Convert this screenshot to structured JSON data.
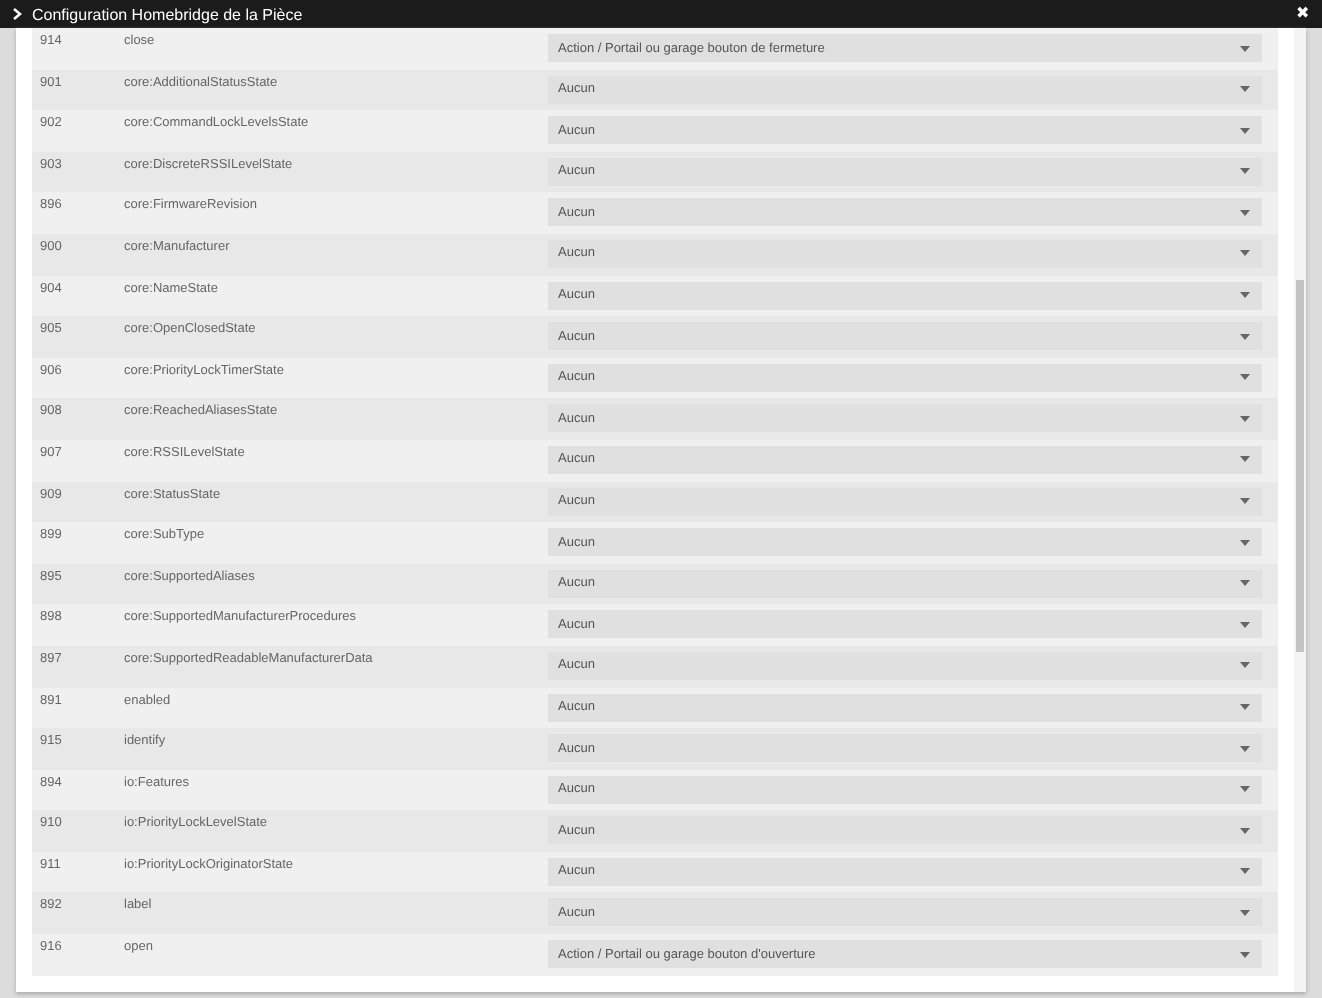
{
  "dialog": {
    "title": "Configuration Homebridge de la Pièce",
    "close": "✖"
  },
  "rows": [
    {
      "id": "914",
      "name": "close",
      "value": "Action / Portail ou garage bouton de fermeture"
    },
    {
      "id": "901",
      "name": "core:AdditionalStatusState",
      "value": "Aucun"
    },
    {
      "id": "902",
      "name": "core:CommandLockLevelsState",
      "value": "Aucun"
    },
    {
      "id": "903",
      "name": "core:DiscreteRSSILevelState",
      "value": "Aucun"
    },
    {
      "id": "896",
      "name": "core:FirmwareRevision",
      "value": "Aucun"
    },
    {
      "id": "900",
      "name": "core:Manufacturer",
      "value": "Aucun"
    },
    {
      "id": "904",
      "name": "core:NameState",
      "value": "Aucun"
    },
    {
      "id": "905",
      "name": "core:OpenClosedState",
      "value": "Aucun"
    },
    {
      "id": "906",
      "name": "core:PriorityLockTimerState",
      "value": "Aucun"
    },
    {
      "id": "908",
      "name": "core:ReachedAliasesState",
      "value": "Aucun"
    },
    {
      "id": "907",
      "name": "core:RSSILevelState",
      "value": "Aucun"
    },
    {
      "id": "909",
      "name": "core:StatusState",
      "value": "Aucun"
    },
    {
      "id": "899",
      "name": "core:SubType",
      "value": "Aucun"
    },
    {
      "id": "895",
      "name": "core:SupportedAliases",
      "value": "Aucun"
    },
    {
      "id": "898",
      "name": "core:SupportedManufacturerProcedures",
      "value": "Aucun"
    },
    {
      "id": "897",
      "name": "core:SupportedReadableManufacturerData",
      "value": "Aucun"
    },
    {
      "id": "891",
      "name": "enabled",
      "value": "Aucun"
    },
    {
      "id": "915",
      "name": "identify",
      "value": "Aucun"
    },
    {
      "id": "894",
      "name": "io:Features",
      "value": "Aucun"
    },
    {
      "id": "910",
      "name": "io:PriorityLockLevelState",
      "value": "Aucun"
    },
    {
      "id": "911",
      "name": "io:PriorityLockOriginatorState",
      "value": "Aucun"
    },
    {
      "id": "892",
      "name": "label",
      "value": "Aucun"
    },
    {
      "id": "916",
      "name": "open",
      "value": "Action / Portail ou garage bouton d'ouverture"
    }
  ]
}
